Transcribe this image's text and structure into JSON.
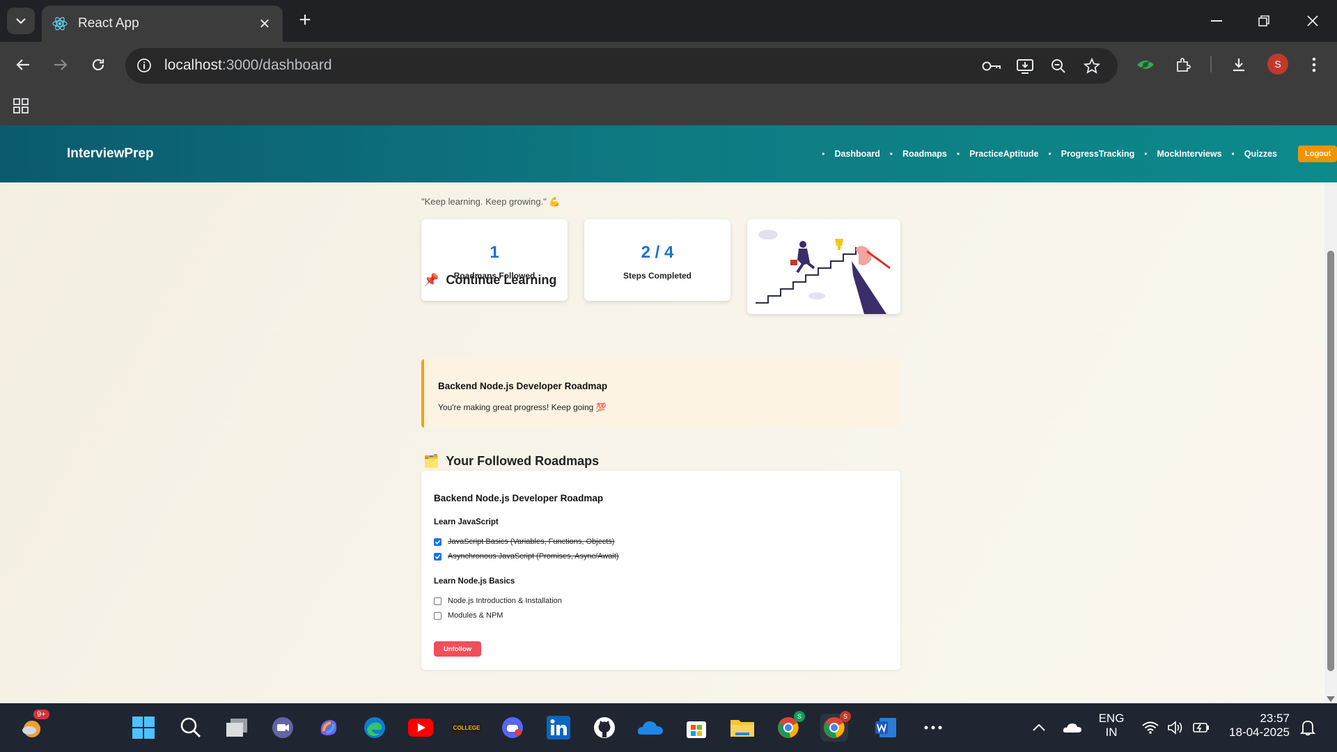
{
  "browser": {
    "tab_title": "React App",
    "url_host": "localhost",
    "url_path": ":3000/dashboard",
    "profile_initial": "S"
  },
  "navbar": {
    "brand": "InterviewPrep",
    "links": [
      "Dashboard",
      "Roadmaps",
      "PracticeAptitude",
      "ProgressTracking",
      "MockInterviews",
      "Quizzes"
    ],
    "logout_label": "Logout"
  },
  "dashboard": {
    "quote": "\"Keep learning. Keep growing.\" 💪",
    "stats": [
      {
        "value": "1",
        "label": "Roadmaps Followed"
      },
      {
        "value": "2 / 4",
        "label": "Steps Completed"
      }
    ],
    "continue_title": "Continue Learning",
    "continue_card": {
      "title": "Backend Node.js Developer Roadmap",
      "message": "You're making great progress! Keep going 💯"
    },
    "followed_title": "Your Followed Roadmaps",
    "roadmap": {
      "title": "Backend Node.js Developer Roadmap",
      "steps": [
        {
          "title": "Learn JavaScript",
          "items": [
            {
              "label": "JavaScript Basics (Variables, Functions, Objects)",
              "done": true
            },
            {
              "label": "Asynchronous JavaScript (Promises, Async/Await)",
              "done": true
            }
          ]
        },
        {
          "title": "Learn Node.js Basics",
          "items": [
            {
              "label": "Node.js Introduction & Installation",
              "done": false
            },
            {
              "label": "Modules & NPM",
              "done": false
            }
          ]
        }
      ],
      "unfollow_label": "Unfollow"
    }
  },
  "taskbar": {
    "weather_badge": "9+",
    "lang_line1": "ENG",
    "lang_line2": "IN",
    "time": "23:57",
    "date": "18-04-2025",
    "college_label": "COLLEGE"
  },
  "colors": {
    "accent_blue": "#1a73c9",
    "navbar_teal": "#0e7a82",
    "logout_orange": "#f29400",
    "unfollow_red": "#ef4f5a"
  }
}
